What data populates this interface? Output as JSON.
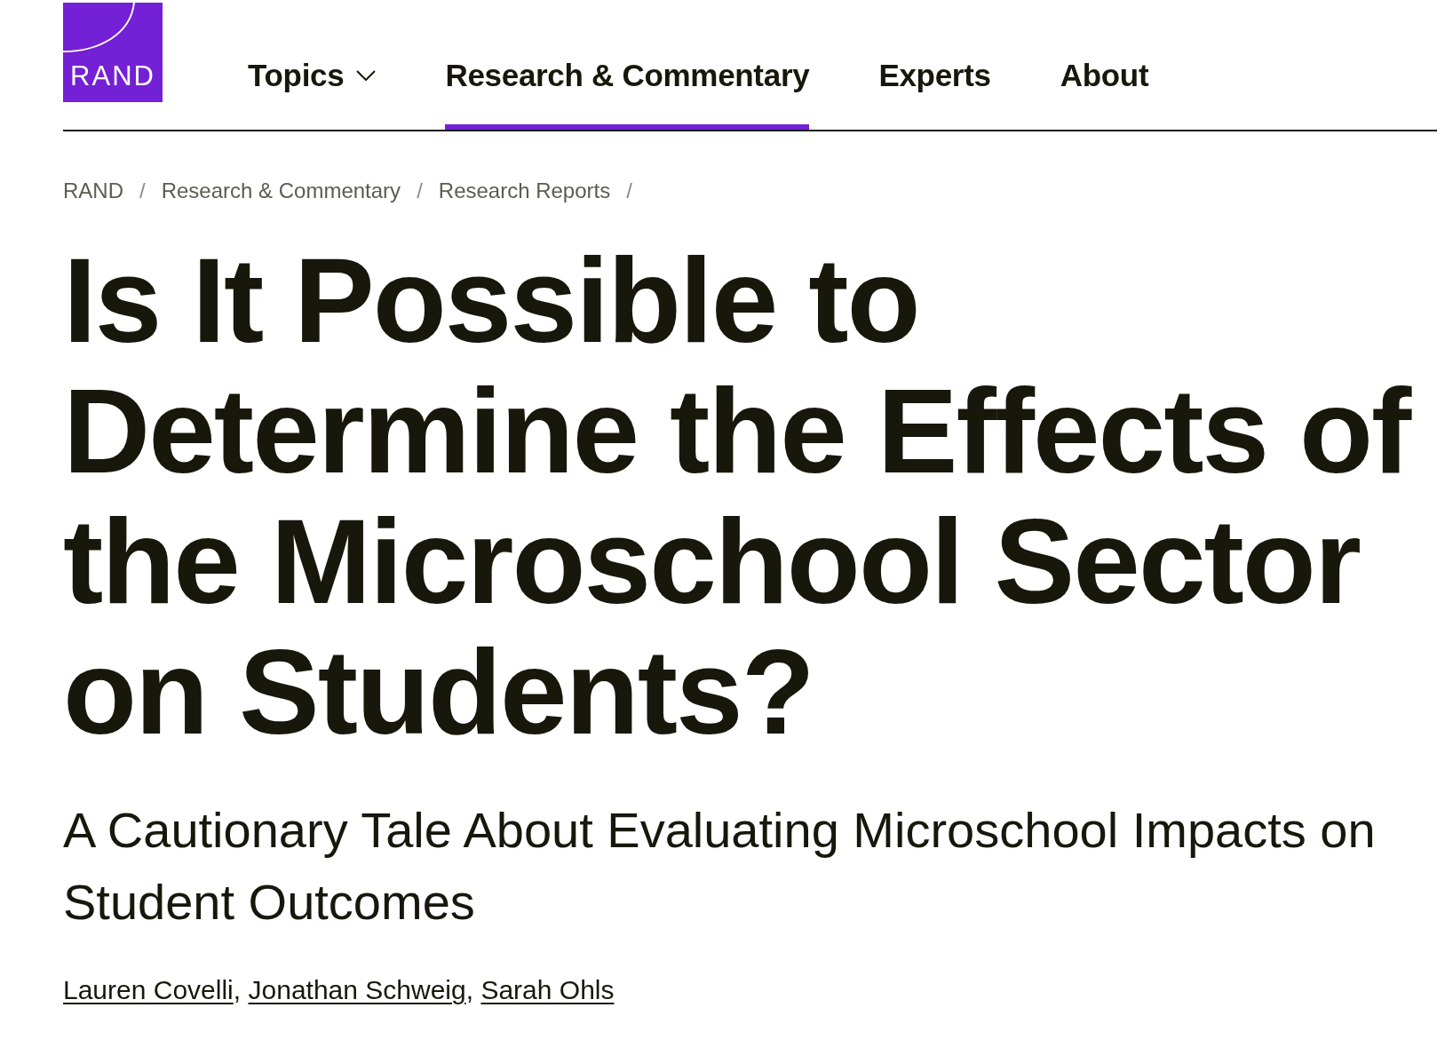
{
  "logo": {
    "text": "RAND"
  },
  "nav": {
    "items": [
      {
        "label": "Topics",
        "kind": "dropdown",
        "selected": false
      },
      {
        "label": "Research & Commentary",
        "kind": "link",
        "selected": true
      },
      {
        "label": "Experts",
        "kind": "link",
        "selected": false
      },
      {
        "label": "About",
        "kind": "link",
        "selected": false
      }
    ]
  },
  "breadcrumb": [
    {
      "label": "RAND",
      "separator": "/"
    },
    {
      "label": "Research & Commentary",
      "separator": "/"
    },
    {
      "label": "Research Reports",
      "separator": "/"
    }
  ],
  "title": "Is It Possible to Determine the Effects of the Microschool Sector on Students?",
  "subtitle": "A Cautionary Tale About Evaluating Microschool Impacts on Student Outcomes",
  "authors": [
    {
      "name": "Lauren Covelli",
      "separator": ","
    },
    {
      "name": "Jonathan Schweig",
      "separator": ","
    },
    {
      "name": "Sarah Ohls"
    }
  ]
}
